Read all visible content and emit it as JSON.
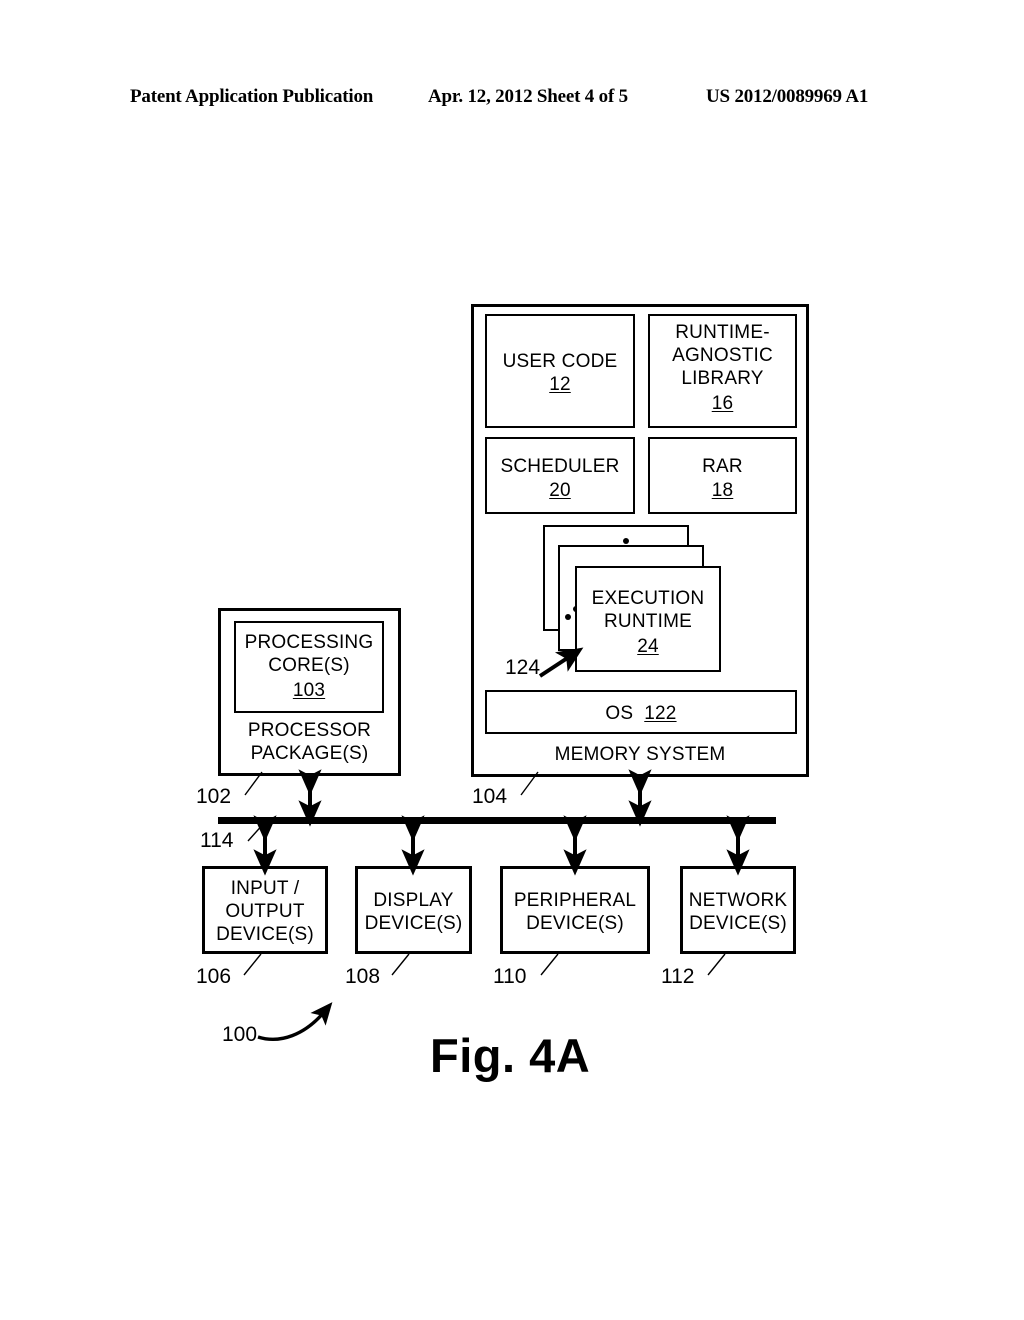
{
  "header": {
    "publication": "Patent Application Publication",
    "date_sheet": "Apr. 12, 2012  Sheet 4 of 5",
    "patent_number": "US 2012/0089969 A1"
  },
  "figure": {
    "caption": "Fig. 4A",
    "system_ref": "100"
  },
  "memory_system": {
    "title": "MEMORY SYSTEM",
    "ref": "104",
    "blocks": {
      "user_code": {
        "label": "USER CODE",
        "ref": "12"
      },
      "rar_library": {
        "label_line1": "RUNTIME-",
        "label_line2": "AGNOSTIC",
        "label_line3": "LIBRARY",
        "ref": "16"
      },
      "scheduler": {
        "label": "SCHEDULER",
        "ref": "20"
      },
      "rar": {
        "label": "RAR",
        "ref": "18"
      },
      "execution_runtime": {
        "label_line1": "EXECUTION",
        "label_line2": "RUNTIME",
        "ref": "24",
        "stack_ref": "124"
      },
      "os": {
        "label": "OS",
        "ref": "122"
      }
    }
  },
  "processor": {
    "package_line1": "PROCESSOR",
    "package_line2": "PACKAGE(S)",
    "package_ref": "102",
    "core_line1": "PROCESSING",
    "core_line2": "CORE(S)",
    "core_ref": "103"
  },
  "bus": {
    "ref": "114"
  },
  "devices": [
    {
      "name": "input-output",
      "lines": [
        "INPUT /",
        "OUTPUT",
        "DEVICE(S)"
      ],
      "ref": "106"
    },
    {
      "name": "display",
      "lines": [
        "DISPLAY",
        "DEVICE(S)"
      ],
      "ref": "108"
    },
    {
      "name": "peripheral",
      "lines": [
        "PERIPHERAL",
        "DEVICE(S)"
      ],
      "ref": "110"
    },
    {
      "name": "network",
      "lines": [
        "NETWORK",
        "DEVICE(S)"
      ],
      "ref": "112"
    }
  ],
  "colors": {
    "ink": "#000000",
    "paper": "#ffffff"
  }
}
